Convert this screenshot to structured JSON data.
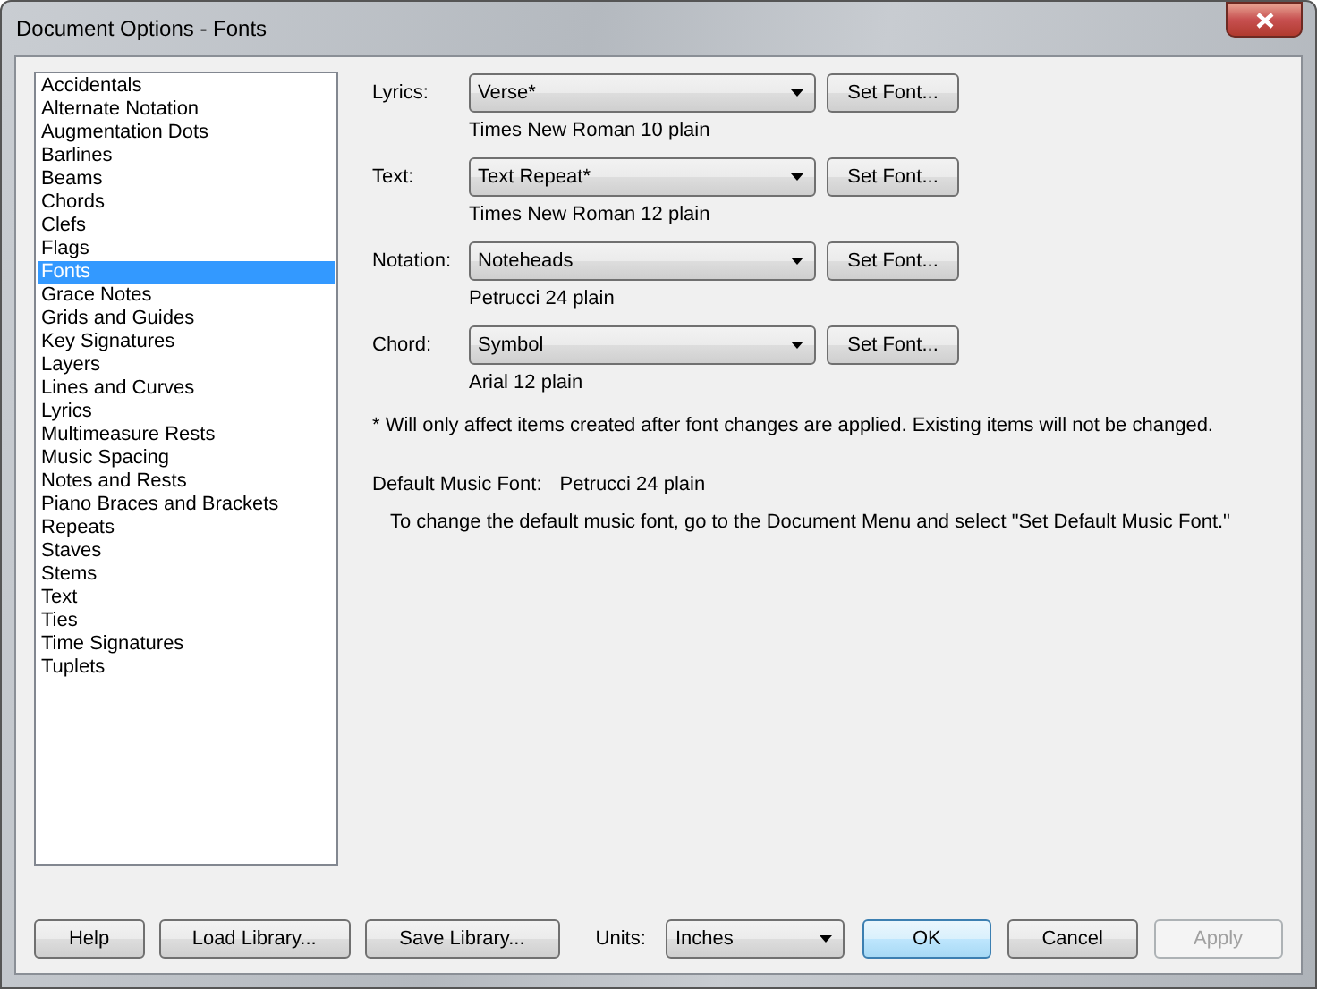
{
  "window": {
    "title": "Document Options - Fonts"
  },
  "categories": [
    {
      "label": "Accidentals",
      "selected": false
    },
    {
      "label": "Alternate Notation",
      "selected": false
    },
    {
      "label": "Augmentation Dots",
      "selected": false
    },
    {
      "label": "Barlines",
      "selected": false
    },
    {
      "label": "Beams",
      "selected": false
    },
    {
      "label": "Chords",
      "selected": false
    },
    {
      "label": "Clefs",
      "selected": false
    },
    {
      "label": "Flags",
      "selected": false
    },
    {
      "label": "Fonts",
      "selected": true
    },
    {
      "label": "Grace Notes",
      "selected": false
    },
    {
      "label": "Grids and Guides",
      "selected": false
    },
    {
      "label": "Key Signatures",
      "selected": false
    },
    {
      "label": "Layers",
      "selected": false
    },
    {
      "label": "Lines and Curves",
      "selected": false
    },
    {
      "label": "Lyrics",
      "selected": false
    },
    {
      "label": "Multimeasure Rests",
      "selected": false
    },
    {
      "label": "Music Spacing",
      "selected": false
    },
    {
      "label": "Notes and Rests",
      "selected": false
    },
    {
      "label": "Piano Braces and Brackets",
      "selected": false
    },
    {
      "label": "Repeats",
      "selected": false
    },
    {
      "label": "Staves",
      "selected": false
    },
    {
      "label": "Stems",
      "selected": false
    },
    {
      "label": "Text",
      "selected": false
    },
    {
      "label": "Ties",
      "selected": false
    },
    {
      "label": "Time Signatures",
      "selected": false
    },
    {
      "label": "Tuplets",
      "selected": false
    }
  ],
  "font_rows": [
    {
      "label": "Lyrics:",
      "value": "Verse*",
      "button": "Set Font...",
      "description": "Times New Roman 10 plain"
    },
    {
      "label": "Text:",
      "value": "Text Repeat*",
      "button": "Set Font...",
      "description": "Times New Roman 12 plain"
    },
    {
      "label": "Notation:",
      "value": "Noteheads",
      "button": "Set Font...",
      "description": "Petrucci 24 plain"
    },
    {
      "label": "Chord:",
      "value": "Symbol",
      "button": "Set Font...",
      "description": "Arial 12 plain"
    }
  ],
  "note": "* Will only affect items created after font changes are applied.  Existing items will not be changed.",
  "default_music_font": {
    "label": "Default Music Font:",
    "value": "Petrucci 24 plain"
  },
  "hint": "To change the default music font, go to the Document Menu and select \"Set Default Music Font.\"",
  "footer": {
    "help": "Help",
    "load": "Load Library...",
    "save": "Save Library...",
    "units_label": "Units:",
    "units_value": "Inches",
    "buttons": [
      {
        "label": "OK",
        "kind": "default",
        "disabled": false
      },
      {
        "label": "Cancel",
        "kind": "normal",
        "disabled": false
      },
      {
        "label": "Apply",
        "kind": "normal",
        "disabled": true
      }
    ]
  }
}
